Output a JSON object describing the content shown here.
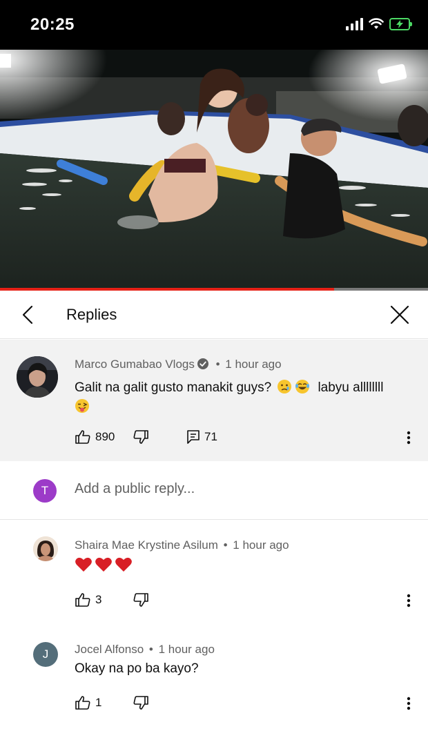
{
  "status_bar": {
    "time": "20:25"
  },
  "video": {
    "progress_fraction": 0.78
  },
  "header": {
    "title": "Replies"
  },
  "pinned_comment": {
    "author": "Marco Gumabao Vlogs",
    "separator": "•",
    "time": "1 hour ago",
    "text_part1": "Galit na galit gusto manakit guys?",
    "text_part2": "labyu allllllll",
    "likes": "890",
    "reply_count": "71"
  },
  "add_reply": {
    "avatar_letter": "T",
    "placeholder": "Add a public reply..."
  },
  "replies": [
    {
      "author": "Shaira Mae Krystine Asilum",
      "separator": "•",
      "time": "1 hour ago",
      "likes": "3"
    },
    {
      "author": "Jocel Alfonso",
      "separator": "•",
      "time": "1 hour ago",
      "text": "Okay na po ba kayo?",
      "likes": "1",
      "avatar_letter": "J"
    }
  ],
  "colors": {
    "progress": "#e62117",
    "add_avatar": "#9c3bc8",
    "reply_avatar": "#546e7a",
    "heart": "#d81f26"
  }
}
